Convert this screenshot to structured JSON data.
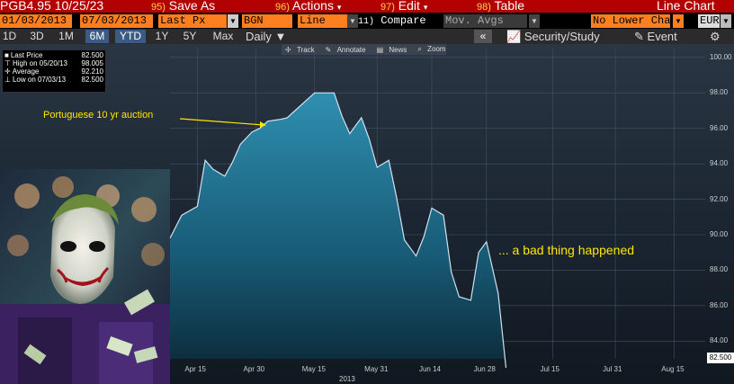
{
  "title_bar": {
    "ticker": "PGB4.95 10/25/23",
    "save": {
      "num": "95)",
      "label": "Save As"
    },
    "actions": {
      "num": "96)",
      "label": "Actions"
    },
    "edit": {
      "num": "97)",
      "label": "Edit"
    },
    "table": {
      "num": "98)",
      "label": "Table"
    },
    "chart_type": "Line Chart"
  },
  "input_bar": {
    "start_date": "01/03/2013",
    "end_date": "07/03/2013",
    "field": "Last Px",
    "source": "BGN",
    "style": "Line",
    "compare_num": "11)",
    "compare_label": "Compare",
    "mov_avgs": "Mov. Avgs",
    "lower_chart": "No Lower Chart",
    "currency": "EUR"
  },
  "range_bar": {
    "ranges": [
      "1D",
      "3D",
      "1M",
      "6M",
      "YTD",
      "1Y",
      "5Y",
      "Max"
    ],
    "active": [
      "6M",
      "YTD"
    ],
    "frequency": "Daily",
    "collapse": "«",
    "security_study": "Security/Study",
    "event": "Event"
  },
  "chart_tools": [
    "Track",
    "Annotate",
    "News",
    "Zoom"
  ],
  "legend": {
    "rows": [
      {
        "label": "Last Price",
        "value": "82.500"
      },
      {
        "label": "High on 05/20/13",
        "value": "98.005"
      },
      {
        "label": "Average",
        "value": "92.210"
      },
      {
        "label": "Low on 07/03/13",
        "value": "82.500"
      }
    ]
  },
  "annotations": {
    "auction": "Portuguese 10 yr auction",
    "bad": "... a bad thing happened"
  },
  "colors": {
    "accent_orange": "#ff7f1e",
    "title_red": "#b30000",
    "annotation_yellow": "#ffe600",
    "series_line": "#cfe3f0"
  },
  "chart_data": {
    "type": "area",
    "title": "",
    "xlabel": "2013",
    "ylabel": "",
    "ylim": [
      83,
      100.5
    ],
    "y_ticks": [
      "100.00",
      "98.00",
      "96.00",
      "94.00",
      "92.00",
      "90.00",
      "88.00",
      "86.00",
      "84.00"
    ],
    "x_ticks": [
      "Apr 15",
      "Apr 30",
      "May 15",
      "May 31",
      "Jun 14",
      "Jun 28",
      "Jul 15",
      "Jul 31",
      "Aug 15"
    ],
    "last_value_label": "82.500",
    "series": [
      {
        "x": [
          "2013-04-08",
          "2013-04-11",
          "2013-04-15",
          "2013-04-17",
          "2013-04-19",
          "2013-04-22",
          "2013-04-24",
          "2013-04-26",
          "2013-04-29",
          "2013-05-01",
          "2013-05-03",
          "2013-05-06",
          "2013-05-08",
          "2013-05-10",
          "2013-05-13",
          "2013-05-15",
          "2013-05-17",
          "2013-05-20",
          "2013-05-22",
          "2013-05-24",
          "2013-05-27",
          "2013-05-29",
          "2013-05-31",
          "2013-06-03",
          "2013-06-05",
          "2013-06-07",
          "2013-06-10",
          "2013-06-12",
          "2013-06-14",
          "2013-06-17",
          "2013-06-19",
          "2013-06-21",
          "2013-06-24",
          "2013-06-26",
          "2013-06-28",
          "2013-07-01",
          "2013-07-03"
        ],
        "values": [
          89.8,
          91.1,
          91.6,
          94.2,
          93.7,
          93.3,
          94.1,
          95.1,
          95.8,
          96.0,
          96.4,
          96.5,
          96.6,
          97.0,
          97.6,
          98.0,
          98.0,
          98.0,
          96.7,
          95.7,
          96.6,
          95.4,
          93.8,
          94.2,
          92.1,
          89.7,
          88.8,
          89.9,
          91.5,
          91.1,
          87.9,
          86.5,
          86.3,
          89.0,
          89.6,
          86.7,
          82.5
        ]
      }
    ]
  }
}
